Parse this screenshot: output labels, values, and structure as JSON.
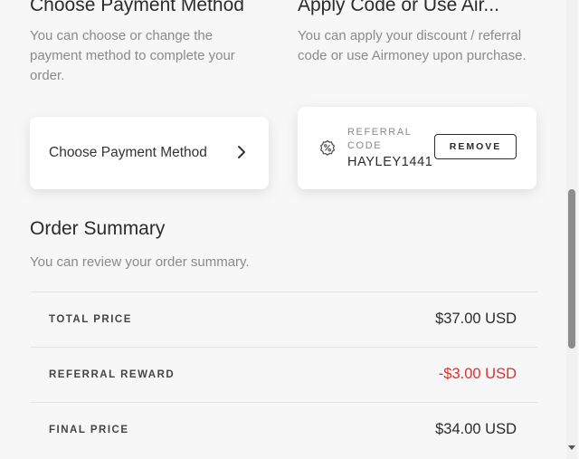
{
  "payment": {
    "title": "Choose Payment Method",
    "description": "You can choose or change the payment method to complete your order.",
    "button_label": "Choose Payment Method"
  },
  "code": {
    "title": "Apply Code or Use Air...",
    "description": "You can apply your discount / referral code or use Airmoney upon purchase.",
    "caption": "REFERRAL CODE",
    "value": "HAYLEY1441",
    "remove_label": "REMOVE"
  },
  "summary": {
    "title": "Order Summary",
    "description": "You can review your order summary.",
    "rows": [
      {
        "label": "TOTAL PRICE",
        "value": "$37.00 USD"
      },
      {
        "label": "REFERRAL REWARD",
        "value": "-$3.00 USD"
      },
      {
        "label": "FINAL PRICE",
        "value": "$34.00 USD"
      }
    ]
  },
  "colors": {
    "negative": "#e22d2d",
    "background": "#f7f7f7"
  },
  "icons": {
    "payment_chevron": "chevron-right-icon",
    "code": "percent-badge-icon"
  }
}
